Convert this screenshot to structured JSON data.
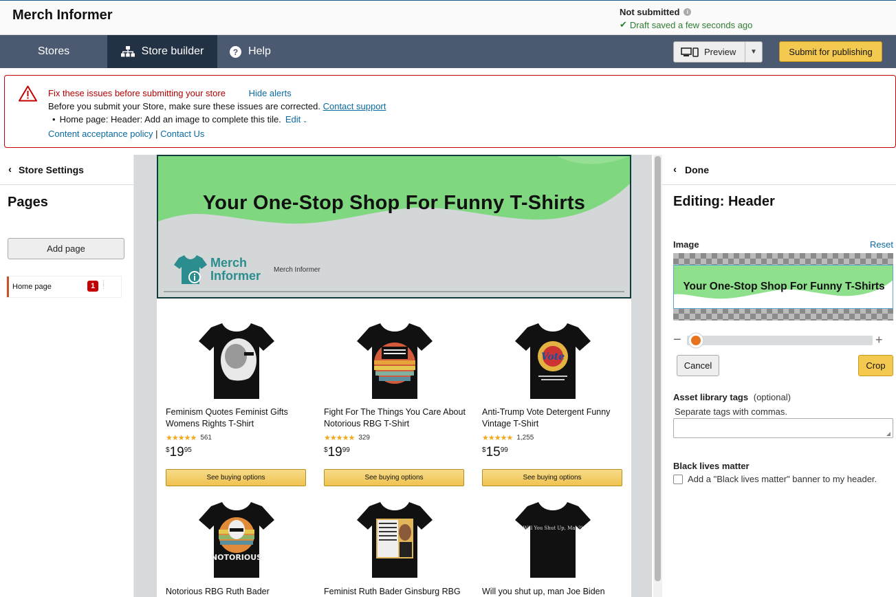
{
  "app": {
    "title": "Merch Informer"
  },
  "status": {
    "title": "Not submitted",
    "draft": "Draft saved a few seconds ago"
  },
  "nav": {
    "tabs": [
      {
        "label": "Stores"
      },
      {
        "label": "Store builder",
        "icon": "sitemap-icon"
      },
      {
        "label": "Help",
        "icon": "help-icon"
      }
    ],
    "preview_label": "Preview",
    "submit_label": "Submit for publishing"
  },
  "alert": {
    "title": "Fix these issues before submitting your store",
    "hide": "Hide alerts",
    "message": "Before you submit your Store, make sure these issues are corrected.",
    "support_link": "Contact support",
    "issue": "Home page: Header: Add an image to complete this tile.",
    "edit": "Edit",
    "policy_link": "Content acceptance policy",
    "separator": "|",
    "contact_link": "Contact Us",
    "color": "#c40000"
  },
  "left": {
    "back_label": "Store Settings",
    "pages_title": "Pages",
    "add_page": "Add page",
    "home_page": "Home page",
    "badge": "1"
  },
  "header_tile": {
    "banner": "Your One-Stop Shop For Funny T-Shirts",
    "logo_line1": "Merch",
    "logo_line2": "Informer",
    "caption": "Merch Informer"
  },
  "products": [
    {
      "title": "Feminism Quotes Feminist Gifts Womens Rights T-Shirt",
      "reviews": "561",
      "price_dollars": "19",
      "price_cents": "95",
      "button": "See buying options",
      "rating": 4.5
    },
    {
      "title": "Fight For The Things You Care About Notorious RBG T-Shirt",
      "reviews": "329",
      "price_dollars": "19",
      "price_cents": "99",
      "button": "See buying options",
      "rating": 4.5
    },
    {
      "title": "Anti-Trump Vote Detergent Funny Vintage T-Shirt",
      "reviews": "1,255",
      "price_dollars": "15",
      "price_cents": "99",
      "button": "See buying options",
      "rating": 4.5
    },
    {
      "title": "Notorious RBG Ruth Bader",
      "shirt_text": "NOTORIOUS"
    },
    {
      "title": "Feminist Ruth Bader Ginsburg RBG"
    },
    {
      "title": "Will you shut up, man Joe Biden",
      "shirt_text": "Will You Shut Up, Man?!"
    }
  ],
  "right": {
    "back_label": "Done",
    "editing_title": "Editing: Header",
    "image_label": "Image",
    "reset": "Reset",
    "crop_preview_text": "Your One-Stop Shop For Funny T-Shirts",
    "cancel": "Cancel",
    "crop": "Crop",
    "tags_label": "Asset library tags",
    "tags_optional": "(optional)",
    "tags_hint": "Separate tags with commas.",
    "tags_value": "",
    "blm_label": "Black lives matter",
    "blm_checkbox": "Add a \"Black lives matter\" banner to my header.",
    "blm_checked": false,
    "zoom_level": 0.0
  },
  "colors": {
    "nav": "#4b5a70",
    "nav_active": "#233145",
    "accent": "#f4c94f",
    "banner_green": "#7fd77f"
  }
}
